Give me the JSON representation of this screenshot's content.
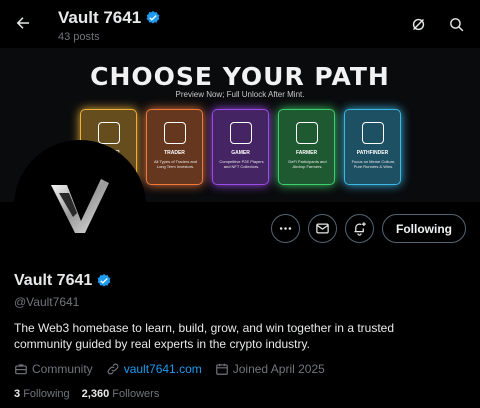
{
  "header": {
    "title": "Vault 7641",
    "post_count": "43 posts"
  },
  "banner": {
    "title": "CHOOSE YOUR PATH",
    "subtitle": "Preview Now; Full Unlock After Mint.",
    "cards": [
      {
        "name": "BUILDER",
        "desc": "",
        "color": "#f0b238"
      },
      {
        "name": "TRADER",
        "desc": "All Types of Traders and Long Term Investors.",
        "color": "#f07a3c"
      },
      {
        "name": "GAMER",
        "desc": "Competitive P2E Players and NFT Collectors.",
        "color": "#9c4ce6"
      },
      {
        "name": "FARMER",
        "desc": "DeFi Participants and Airdrop Farmers.",
        "color": "#3ecf6c"
      },
      {
        "name": "PATHFINDER",
        "desc": "Focus on Meme Culture, Pure Runners & Wins.",
        "color": "#3cb8e6"
      }
    ]
  },
  "actions": {
    "follow_label": "Following"
  },
  "profile": {
    "name": "Vault 7641",
    "handle": "@Vault7641",
    "bio": "The Web3 homebase to learn, build, grow, and win together in a trusted community guided by real experts in the crypto industry.",
    "category": "Community",
    "website": "vault7641.com",
    "joined": "Joined April 2025",
    "following_count": "3",
    "following_label": "Following",
    "followers_count": "2,360",
    "followers_label": "Followers"
  },
  "colors": {
    "verified": "#1d9bf0",
    "link": "#1d9bf0",
    "muted": "#71767b"
  }
}
